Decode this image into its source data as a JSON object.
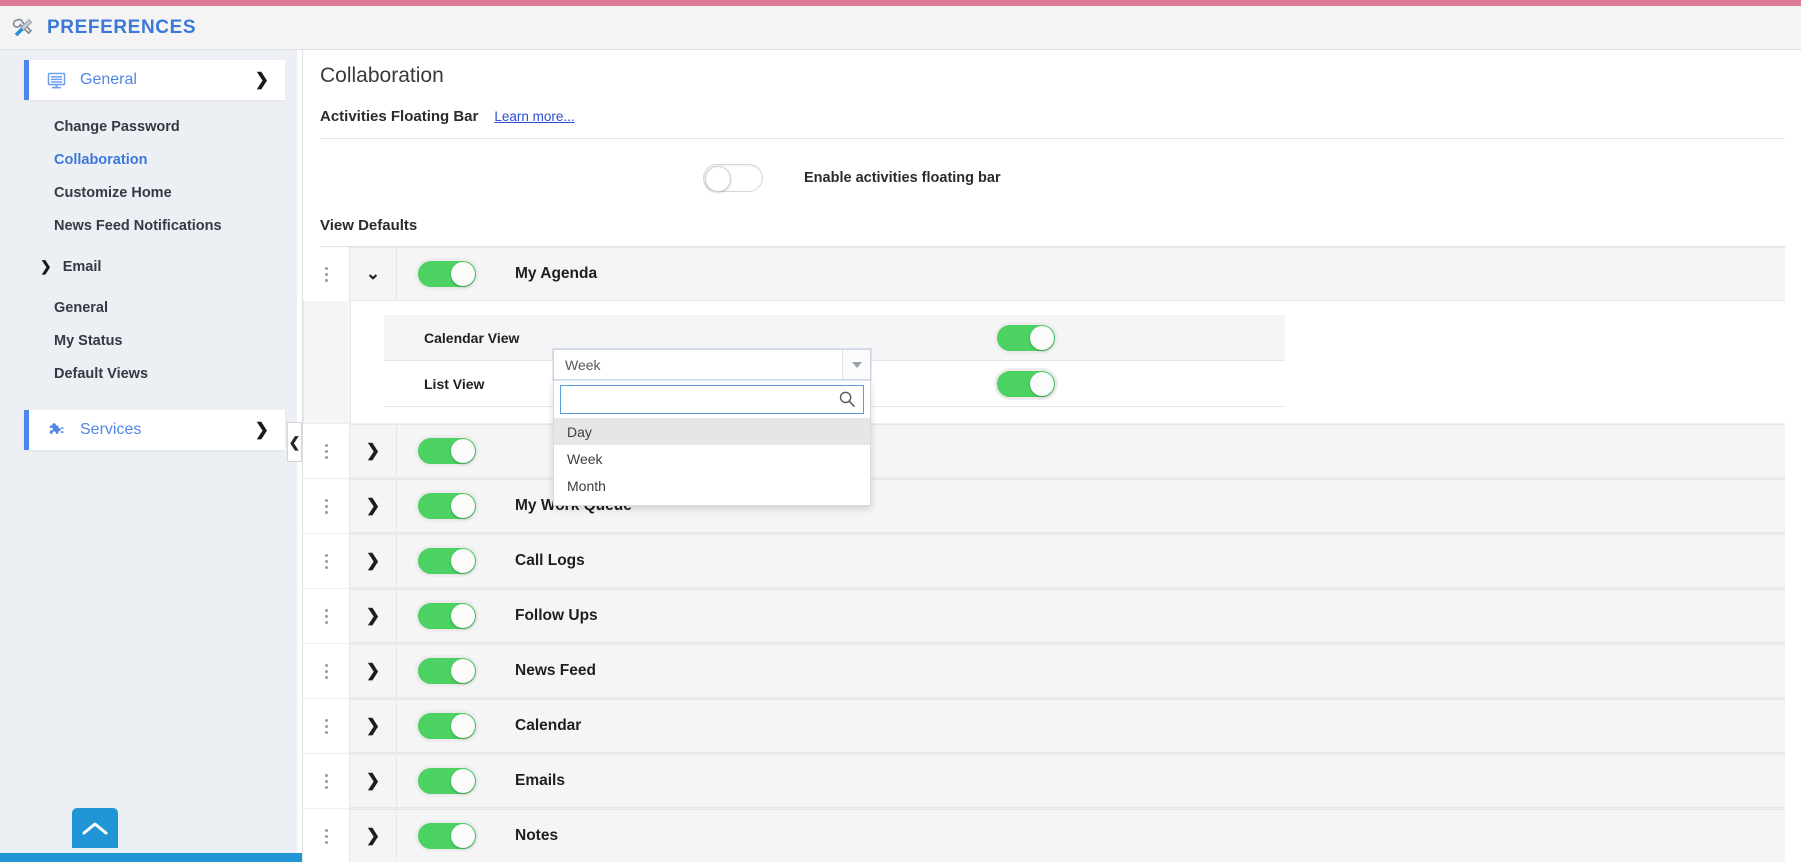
{
  "header": {
    "title": "PREFERENCES",
    "icon": "tools-wrench-screwdriver-icon"
  },
  "sidebar": {
    "groups": [
      {
        "label": "General",
        "icon": "monitor-icon",
        "chevron": "❯",
        "items": [
          {
            "label": "Change Password",
            "active": false
          },
          {
            "label": "Collaboration",
            "active": true
          },
          {
            "label": "Customize Home",
            "active": false
          },
          {
            "label": "News Feed Notifications",
            "active": false
          }
        ]
      }
    ],
    "email_group": {
      "label": "Email",
      "chevron": "❯",
      "items": [
        {
          "label": "General"
        },
        {
          "label": "My Status"
        },
        {
          "label": "Default Views"
        }
      ]
    },
    "services": {
      "label": "Services",
      "icon": "puzzle-piece-icon",
      "chevron": "❯"
    },
    "collapse_handle": "❮",
    "scroll_top_icon": "chevron-up-icon"
  },
  "main": {
    "page_title": "Collaboration",
    "activities_section": {
      "title": "Activities Floating Bar",
      "learn_more": "Learn more...",
      "toggle_label": "Enable activities floating bar",
      "toggle_state": "off"
    },
    "view_defaults": {
      "title": "View Defaults",
      "rows": [
        {
          "label": "My Agenda",
          "expanded": true,
          "toggle_state": "on",
          "chevron": "⌄",
          "sub_rows": [
            {
              "label": "Calendar View",
              "toggle_state": "on",
              "has_select": true
            },
            {
              "label": "List View",
              "toggle_state": "on",
              "has_select": false
            }
          ]
        },
        {
          "label": "",
          "expanded": false,
          "toggle_state": "on",
          "chevron": "❯"
        },
        {
          "label": "My Work Queue",
          "expanded": false,
          "toggle_state": "on",
          "chevron": "❯"
        },
        {
          "label": "Call Logs",
          "expanded": false,
          "toggle_state": "on",
          "chevron": "❯"
        },
        {
          "label": "Follow Ups",
          "expanded": false,
          "toggle_state": "on",
          "chevron": "❯"
        },
        {
          "label": "News Feed",
          "expanded": false,
          "toggle_state": "on",
          "chevron": "❯"
        },
        {
          "label": "Calendar",
          "expanded": false,
          "toggle_state": "on",
          "chevron": "❯"
        },
        {
          "label": "Emails",
          "expanded": false,
          "toggle_state": "on",
          "chevron": "❯"
        },
        {
          "label": "Notes",
          "expanded": false,
          "toggle_state": "on",
          "chevron": "❯"
        }
      ]
    },
    "calendar_view_select": {
      "selected_value": "Week",
      "search_value": "",
      "search_placeholder": "",
      "search_icon": "magnifier-icon",
      "arrow_icon": "caret-down-icon",
      "options": [
        {
          "label": "Day",
          "highlighted": true
        },
        {
          "label": "Week",
          "highlighted": false
        },
        {
          "label": "Month",
          "highlighted": false
        }
      ]
    }
  },
  "colors": {
    "accent_top": "#dd7a96",
    "brand_blue": "#3c78d8",
    "toggle_on": "#4bd263",
    "link_blue": "#2a4fd6",
    "scroll_button": "#2196d6"
  }
}
